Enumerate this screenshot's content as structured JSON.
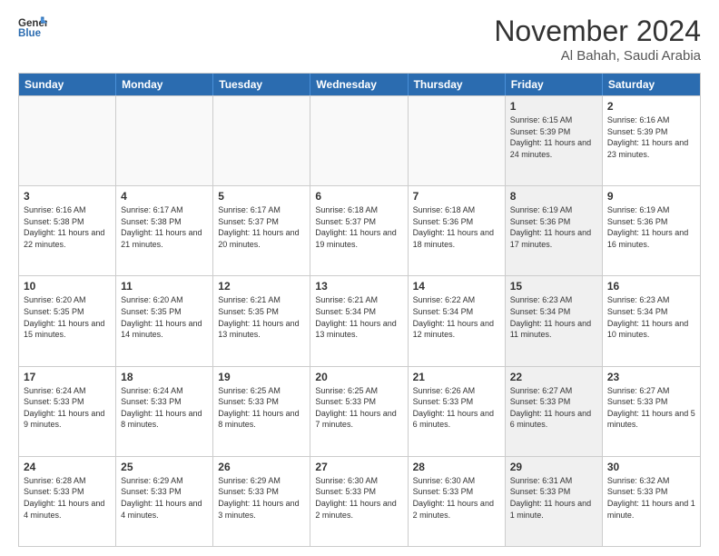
{
  "header": {
    "logo_line1": "General",
    "logo_line2": "Blue",
    "month": "November 2024",
    "location": "Al Bahah, Saudi Arabia"
  },
  "weekdays": [
    "Sunday",
    "Monday",
    "Tuesday",
    "Wednesday",
    "Thursday",
    "Friday",
    "Saturday"
  ],
  "weeks": [
    [
      {
        "day": "",
        "info": "",
        "empty": true
      },
      {
        "day": "",
        "info": "",
        "empty": true
      },
      {
        "day": "",
        "info": "",
        "empty": true
      },
      {
        "day": "",
        "info": "",
        "empty": true
      },
      {
        "day": "",
        "info": "",
        "empty": true
      },
      {
        "day": "1",
        "info": "Sunrise: 6:15 AM\nSunset: 5:39 PM\nDaylight: 11 hours\nand 24 minutes.",
        "shaded": true
      },
      {
        "day": "2",
        "info": "Sunrise: 6:16 AM\nSunset: 5:39 PM\nDaylight: 11 hours\nand 23 minutes.",
        "shaded": false
      }
    ],
    [
      {
        "day": "3",
        "info": "Sunrise: 6:16 AM\nSunset: 5:38 PM\nDaylight: 11 hours\nand 22 minutes.",
        "shaded": false
      },
      {
        "day": "4",
        "info": "Sunrise: 6:17 AM\nSunset: 5:38 PM\nDaylight: 11 hours\nand 21 minutes.",
        "shaded": false
      },
      {
        "day": "5",
        "info": "Sunrise: 6:17 AM\nSunset: 5:37 PM\nDaylight: 11 hours\nand 20 minutes.",
        "shaded": false
      },
      {
        "day": "6",
        "info": "Sunrise: 6:18 AM\nSunset: 5:37 PM\nDaylight: 11 hours\nand 19 minutes.",
        "shaded": false
      },
      {
        "day": "7",
        "info": "Sunrise: 6:18 AM\nSunset: 5:36 PM\nDaylight: 11 hours\nand 18 minutes.",
        "shaded": false
      },
      {
        "day": "8",
        "info": "Sunrise: 6:19 AM\nSunset: 5:36 PM\nDaylight: 11 hours\nand 17 minutes.",
        "shaded": true
      },
      {
        "day": "9",
        "info": "Sunrise: 6:19 AM\nSunset: 5:36 PM\nDaylight: 11 hours\nand 16 minutes.",
        "shaded": false
      }
    ],
    [
      {
        "day": "10",
        "info": "Sunrise: 6:20 AM\nSunset: 5:35 PM\nDaylight: 11 hours\nand 15 minutes.",
        "shaded": false
      },
      {
        "day": "11",
        "info": "Sunrise: 6:20 AM\nSunset: 5:35 PM\nDaylight: 11 hours\nand 14 minutes.",
        "shaded": false
      },
      {
        "day": "12",
        "info": "Sunrise: 6:21 AM\nSunset: 5:35 PM\nDaylight: 11 hours\nand 13 minutes.",
        "shaded": false
      },
      {
        "day": "13",
        "info": "Sunrise: 6:21 AM\nSunset: 5:34 PM\nDaylight: 11 hours\nand 13 minutes.",
        "shaded": false
      },
      {
        "day": "14",
        "info": "Sunrise: 6:22 AM\nSunset: 5:34 PM\nDaylight: 11 hours\nand 12 minutes.",
        "shaded": false
      },
      {
        "day": "15",
        "info": "Sunrise: 6:23 AM\nSunset: 5:34 PM\nDaylight: 11 hours\nand 11 minutes.",
        "shaded": true
      },
      {
        "day": "16",
        "info": "Sunrise: 6:23 AM\nSunset: 5:34 PM\nDaylight: 11 hours\nand 10 minutes.",
        "shaded": false
      }
    ],
    [
      {
        "day": "17",
        "info": "Sunrise: 6:24 AM\nSunset: 5:33 PM\nDaylight: 11 hours\nand 9 minutes.",
        "shaded": false
      },
      {
        "day": "18",
        "info": "Sunrise: 6:24 AM\nSunset: 5:33 PM\nDaylight: 11 hours\nand 8 minutes.",
        "shaded": false
      },
      {
        "day": "19",
        "info": "Sunrise: 6:25 AM\nSunset: 5:33 PM\nDaylight: 11 hours\nand 8 minutes.",
        "shaded": false
      },
      {
        "day": "20",
        "info": "Sunrise: 6:25 AM\nSunset: 5:33 PM\nDaylight: 11 hours\nand 7 minutes.",
        "shaded": false
      },
      {
        "day": "21",
        "info": "Sunrise: 6:26 AM\nSunset: 5:33 PM\nDaylight: 11 hours\nand 6 minutes.",
        "shaded": false
      },
      {
        "day": "22",
        "info": "Sunrise: 6:27 AM\nSunset: 5:33 PM\nDaylight: 11 hours\nand 6 minutes.",
        "shaded": true
      },
      {
        "day": "23",
        "info": "Sunrise: 6:27 AM\nSunset: 5:33 PM\nDaylight: 11 hours\nand 5 minutes.",
        "shaded": false
      }
    ],
    [
      {
        "day": "24",
        "info": "Sunrise: 6:28 AM\nSunset: 5:33 PM\nDaylight: 11 hours\nand 4 minutes.",
        "shaded": false
      },
      {
        "day": "25",
        "info": "Sunrise: 6:29 AM\nSunset: 5:33 PM\nDaylight: 11 hours\nand 4 minutes.",
        "shaded": false
      },
      {
        "day": "26",
        "info": "Sunrise: 6:29 AM\nSunset: 5:33 PM\nDaylight: 11 hours\nand 3 minutes.",
        "shaded": false
      },
      {
        "day": "27",
        "info": "Sunrise: 6:30 AM\nSunset: 5:33 PM\nDaylight: 11 hours\nand 2 minutes.",
        "shaded": false
      },
      {
        "day": "28",
        "info": "Sunrise: 6:30 AM\nSunset: 5:33 PM\nDaylight: 11 hours\nand 2 minutes.",
        "shaded": false
      },
      {
        "day": "29",
        "info": "Sunrise: 6:31 AM\nSunset: 5:33 PM\nDaylight: 11 hours\nand 1 minute.",
        "shaded": true
      },
      {
        "day": "30",
        "info": "Sunrise: 6:32 AM\nSunset: 5:33 PM\nDaylight: 11 hours\nand 1 minute.",
        "shaded": false
      }
    ]
  ]
}
